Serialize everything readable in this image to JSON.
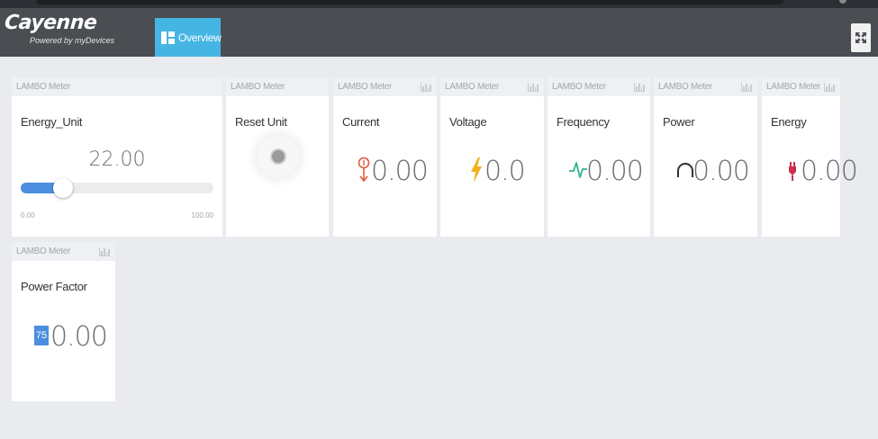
{
  "app": {
    "logo_name": "Cayenne",
    "logo_sub": "Powered by myDevices",
    "accent": "#45b6e3"
  },
  "nav": {
    "overview_label": "Overview",
    "fullscreen_icon": "expand-icon"
  },
  "widgets": [
    {
      "device": "LAMBO Meter",
      "title": "Energy_Unit",
      "type": "slider",
      "value": "22.00",
      "min": "0.00",
      "max": "100.00",
      "fraction": 0.22
    },
    {
      "device": "LAMBO Meter",
      "title": "Reset Unit",
      "type": "button"
    },
    {
      "device": "LAMBO Meter",
      "title": "Current",
      "value": "0.00",
      "icon": "current-icon",
      "icon_color": "#e05a3c"
    },
    {
      "device": "LAMBO Meter",
      "title": "Voltage",
      "value": "0.0",
      "icon": "lightning-icon",
      "icon_color": "#f2b01e"
    },
    {
      "device": "LAMBO Meter",
      "title": "Frequency",
      "value": "0.00",
      "icon": "pulse-icon",
      "icon_color": "#2bb58f"
    },
    {
      "device": "LAMBO Meter",
      "title": "Power",
      "value": "0.00",
      "icon": "arc-icon",
      "icon_color": "#333333"
    },
    {
      "device": "LAMBO Meter",
      "title": "Energy",
      "value": "0.00",
      "icon": "plug-icon",
      "icon_color": "#c9304b"
    },
    {
      "device": "LAMBO Meter",
      "title": "Power Factor",
      "value": "0.00",
      "icon": "gauge-badge-icon",
      "badge": "75",
      "icon_color": "#4c8fe0"
    }
  ]
}
